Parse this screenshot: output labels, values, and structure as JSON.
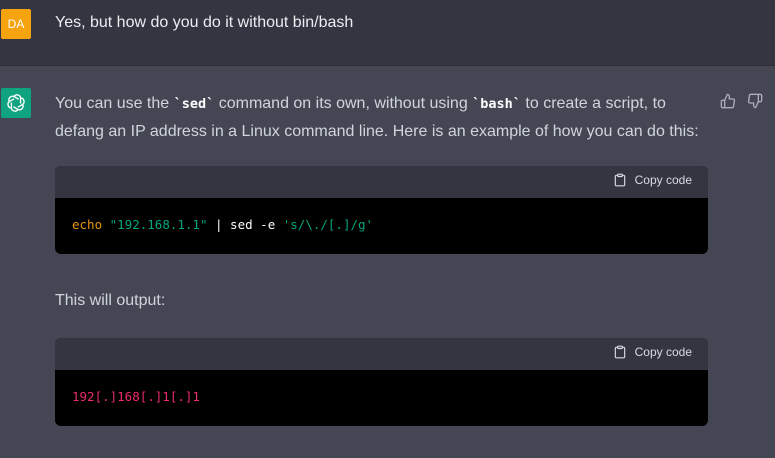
{
  "user_message": {
    "avatar_initials": "DA",
    "text": "Yes, but how do you do it without bin/bash"
  },
  "assistant_message": {
    "avatar_icon": "openai-logo-icon",
    "paragraph1": {
      "part1": "You can use the ",
      "code1": "`sed`",
      "part2": " command on its own, without using ",
      "code2": "`bash`",
      "part3": " to create a script, to defang an IP address in a Linux command line. Here is an example of how you can do this:"
    },
    "code_block_1": {
      "copy_label": "Copy code",
      "tokens": {
        "cmd": "echo",
        "str1": "\"192.168.1.1\"",
        "pipe": " | sed -e ",
        "str2": "'s/\\./[.]/g'"
      }
    },
    "paragraph2": "This will output:",
    "code_block_2": {
      "copy_label": "Copy code",
      "output": "192[.]168[.]1[.]1"
    }
  },
  "colors": {
    "user_avatar": "#f5a30f",
    "bot_avatar": "#10a37f",
    "user_bg": "#343541",
    "assistant_bg": "#444654"
  }
}
